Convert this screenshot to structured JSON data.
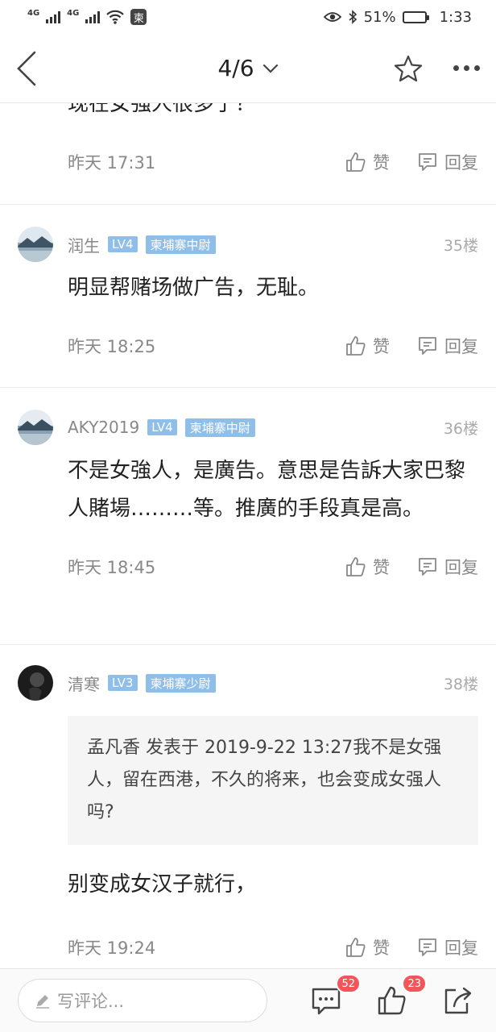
{
  "status_bar": {
    "net1": "4G",
    "net2": "4G",
    "app_badge": "柬",
    "battery": "51%",
    "time": "1:33"
  },
  "nav": {
    "page_indicator": "4/6"
  },
  "partial_post": {
    "text": "现在女强人很多了？",
    "time": "昨天 17:31",
    "like_label": "赞",
    "reply_label": "回复"
  },
  "posts": [
    {
      "username": "润生",
      "level": "LV4",
      "rank": "柬埔寨中尉",
      "floor": "35楼",
      "text": "明显帮赌场做广告，无耻。",
      "time": "昨天 18:25",
      "like_label": "赞",
      "reply_label": "回复"
    },
    {
      "username": "AKY2019",
      "level": "LV4",
      "rank": "柬埔寨中尉",
      "floor": "36楼",
      "text": "不是女強人，是廣告。意思是告訴大家巴黎人賭場………等。推廣的手段真是高。",
      "time": "昨天 18:45",
      "like_label": "赞",
      "reply_label": "回复"
    },
    {
      "username": "清寒",
      "level": "LV3",
      "rank": "柬埔寨少尉",
      "floor": "38楼",
      "quote": "孟凡香 发表于 2019-9-22 13:27我不是女强人，留在西港，不久的将来，也会变成女强人吗?",
      "text": "别变成女汉子就行，",
      "time": "昨天 19:24",
      "like_label": "赞",
      "reply_label": "回复"
    }
  ],
  "bottom_bar": {
    "comment_placeholder": "写评论...",
    "comment_count": "52",
    "like_count": "23"
  },
  "colors": {
    "badge_red": "#f4555a",
    "level_blue": "#8fbfe8"
  }
}
